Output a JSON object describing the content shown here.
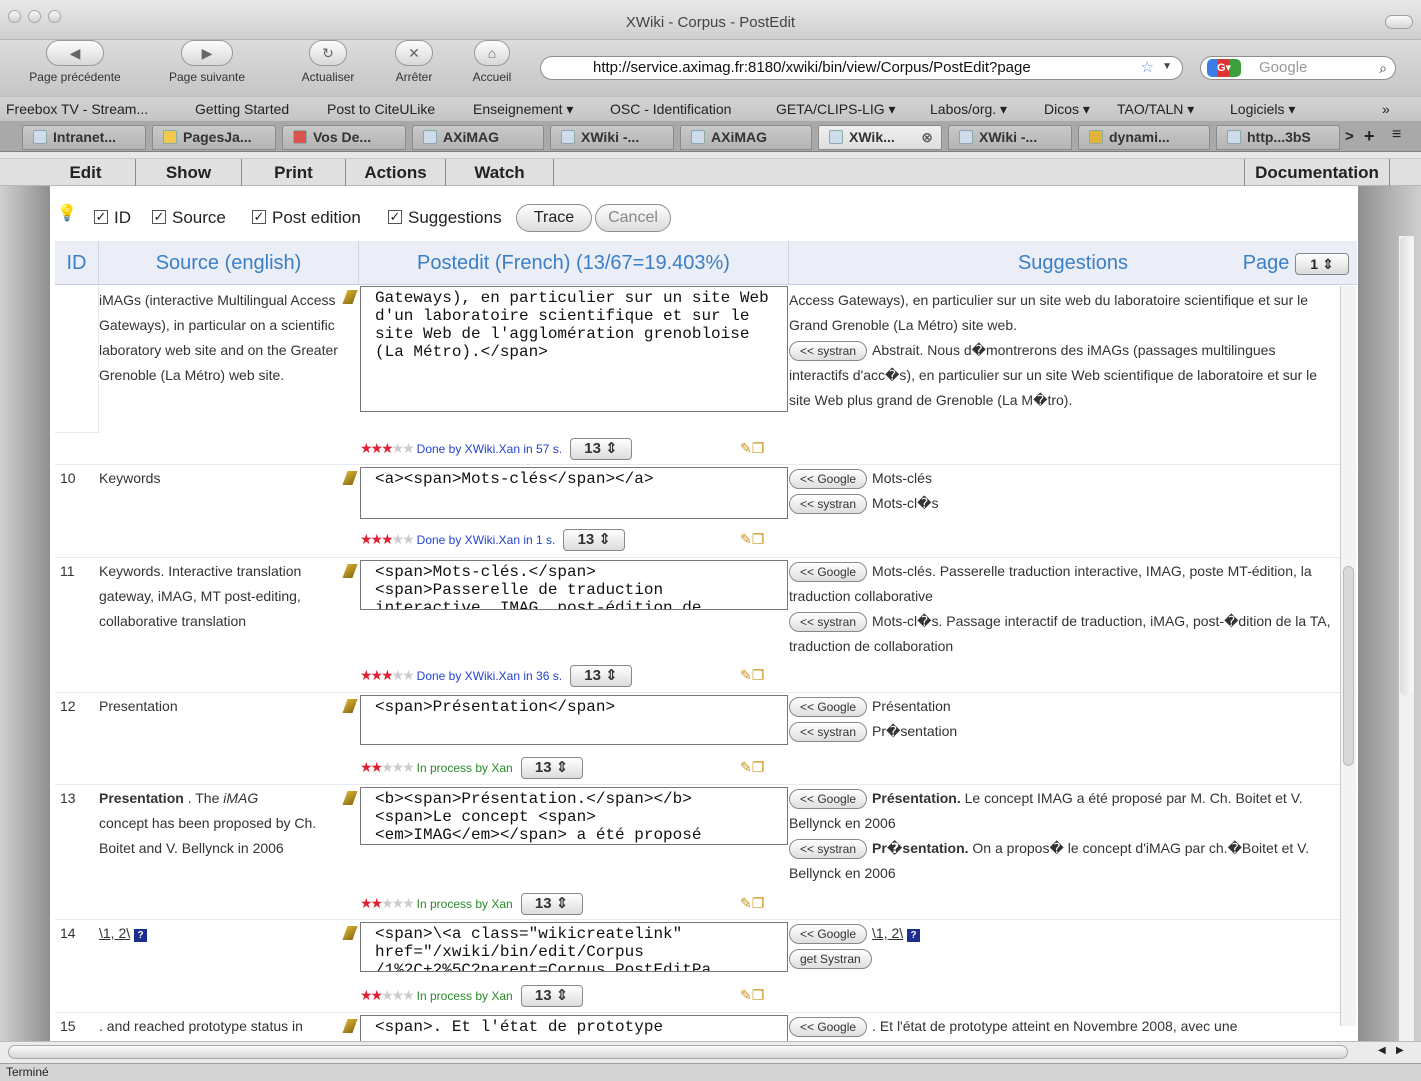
{
  "window": {
    "title": "XWiki - Corpus - PostEdit"
  },
  "toolbar": {
    "back": "Page précédente",
    "forward": "Page suivante",
    "reload": "Actualiser",
    "stop": "Arrêter",
    "home": "Accueil",
    "url": "http://service.aximag.fr:8180/xwiki/bin/view/Corpus/PostEdit?page",
    "search_placeholder": "Google"
  },
  "bookmarks": [
    "Freebox TV - Stream...",
    "Getting Started",
    "Post to CiteULike",
    "Enseignement ▾",
    "OSC - Identification",
    "GETA/CLIPS-LIG ▾",
    "Labos/org. ▾",
    "Dicos ▾",
    "TAO/TALN ▾",
    "Logiciels ▾",
    "»"
  ],
  "tabs": [
    "Intranet...",
    "PagesJa...",
    "Vos De...",
    "AXiMAG",
    "XWiki -...",
    "AXiMAG",
    "XWik...",
    "XWiki -...",
    "dynami...",
    "http...3bS"
  ],
  "menu": {
    "edit": "Edit",
    "show": "Show",
    "print": "Print",
    "actions": "Actions",
    "watch": "Watch",
    "documentation": "Documentation"
  },
  "controls": {
    "id": "ID",
    "source": "Source",
    "post": "Post edition",
    "suggestions": "Suggestions",
    "trace": "Trace",
    "cancel": "Cancel"
  },
  "header": {
    "id": "ID",
    "source": "Source (english)",
    "postedit": "Postedit (French) (13/67=19.403%)",
    "suggestions": "Suggestions",
    "page_label": "Page",
    "page_value": "1"
  },
  "rows": [
    {
      "id": "",
      "source": "iMAGs (interactive Multilingual Access Gateways), in particular on a scientific laboratory web site and on the Greater Grenoble (La Métro) web site.",
      "post": "Gateways), en particulier sur un site Web d'un laboratoire scientifique et sur le site Web de l'agglomération grenobloise (La Métro).</span>",
      "google": "Access Gateways), en particulier sur un site web du laboratoire scientifique et sur le Grand Grenoble (La Métro) site web.",
      "systran": "Abstrait. Nous d�montrerons des iMAGs (passages multilingues interactifs d'acc�s), en particulier sur un site Web scientifique de laboratoire et sur le site Web plus grand de Grenoble (La M�tro).",
      "status": "Done by XWiki.Xan in 57 s.",
      "count": "13"
    },
    {
      "id": "10",
      "source": "Keywords",
      "post": "<a><span>Mots-clés</span></a>",
      "google": "Mots-clés",
      "systran": "Mots-cl�s",
      "status": "Done by XWiki.Xan in 1 s.",
      "count": "13"
    },
    {
      "id": "11",
      "source": "Keywords. Interactive translation gateway, iMAG, MT post-editing, collaborative translation",
      "post": "<span>Mots-clés.</span>\n<span>Passerelle de traduction\ninteractive, IMAG, post-édition de",
      "google": "Mots-clés. Passerelle traduction interactive, IMAG, poste MT-édition, la traduction collaborative",
      "systran": "Mots-cl�s. Passage interactif de traduction, iMAG, post-�dition de la TA, traduction de collaboration",
      "status": "Done by XWiki.Xan in 36 s.",
      "count": "13"
    },
    {
      "id": "12",
      "source": "Presentation",
      "post": "<span>Présentation</span>",
      "google": "Présentation",
      "systran": "Pr�sentation",
      "status": "In process by Xan",
      "count": "13"
    },
    {
      "id": "13",
      "source_bold": "Presentation",
      "source_rest1": " . The ",
      "source_em": "iMAG",
      "source_rest2": "concept has been proposed by Ch. Boitet and V. Bellynck in 2006",
      "post": "<b><span>Présentation.</span></b>\n<span>Le concept <span>\n<em>IMAG</em></span> a été proposé",
      "google_bold": "Présentation.",
      "google_rest": " Le concept IMAG a été proposé par M. Ch. Boitet et V. Bellynck en 2006",
      "systran_bold": "Pr�sentation.",
      "systran_rest": " On a propos� le concept d'iMAG par ch.�Boitet et V. Bellynck en 2006",
      "status": "In process by Xan",
      "count": "13"
    },
    {
      "id": "14",
      "source": "\\1, 2\\",
      "post": "<span>\\<a class=\"wikicreatelink\"\nhref=\"/xwiki/bin/edit/Corpus\n/1%2C+2%5C?parent=Corpus.PostEditPa",
      "google": "\\1, 2\\",
      "systran_btn": "get Systran",
      "status": "In process by Xan",
      "count": "13"
    },
    {
      "id": "15",
      "source": ". and reached prototype status in",
      "post": "<span>. Et l'état de prototype",
      "google": ". Et l'état de prototype atteint en Novembre 2008, avec une"
    }
  ],
  "labels": {
    "google_btn": "<< Google",
    "systran_btn": "<< systran",
    "qmark": "?"
  },
  "status_bar": "Terminé"
}
